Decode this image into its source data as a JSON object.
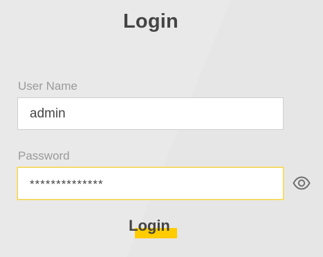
{
  "page": {
    "title": "Login"
  },
  "username": {
    "label": "User Name",
    "value": "admin"
  },
  "password": {
    "label": "Password",
    "value": "**************"
  },
  "login_button": {
    "label": "Login"
  },
  "icons": {
    "password_toggle": "eye-icon"
  },
  "colors": {
    "accent": "#ffcc00",
    "focus_border": "#f2d24e",
    "text": "#444444",
    "label_text": "#9a9a9a"
  }
}
